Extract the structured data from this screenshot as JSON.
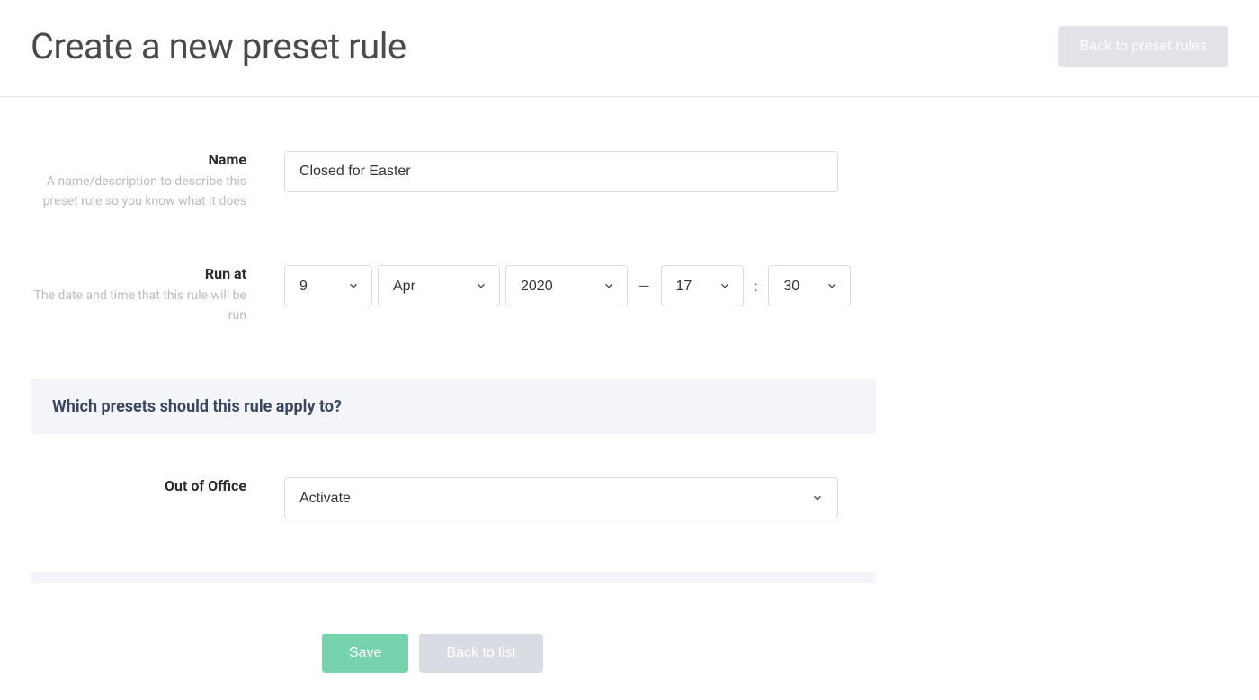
{
  "header": {
    "title": "Create a new preset rule",
    "back_button": "Back to preset rules"
  },
  "form": {
    "name": {
      "label": "Name",
      "help": "A name/description to describe this preset rule so you know what it does",
      "value": "Closed for Easter"
    },
    "run_at": {
      "label": "Run at",
      "help": "The date and time that this rule will be run",
      "day": "9",
      "month": "Apr",
      "year": "2020",
      "hour": "17",
      "minute": "30",
      "dash": "—",
      "colon": ":"
    },
    "section_heading": "Which presets should this rule apply to?",
    "preset": {
      "label": "Out of Office",
      "value": "Activate"
    }
  },
  "footer": {
    "save": "Save",
    "back": "Back to list"
  }
}
